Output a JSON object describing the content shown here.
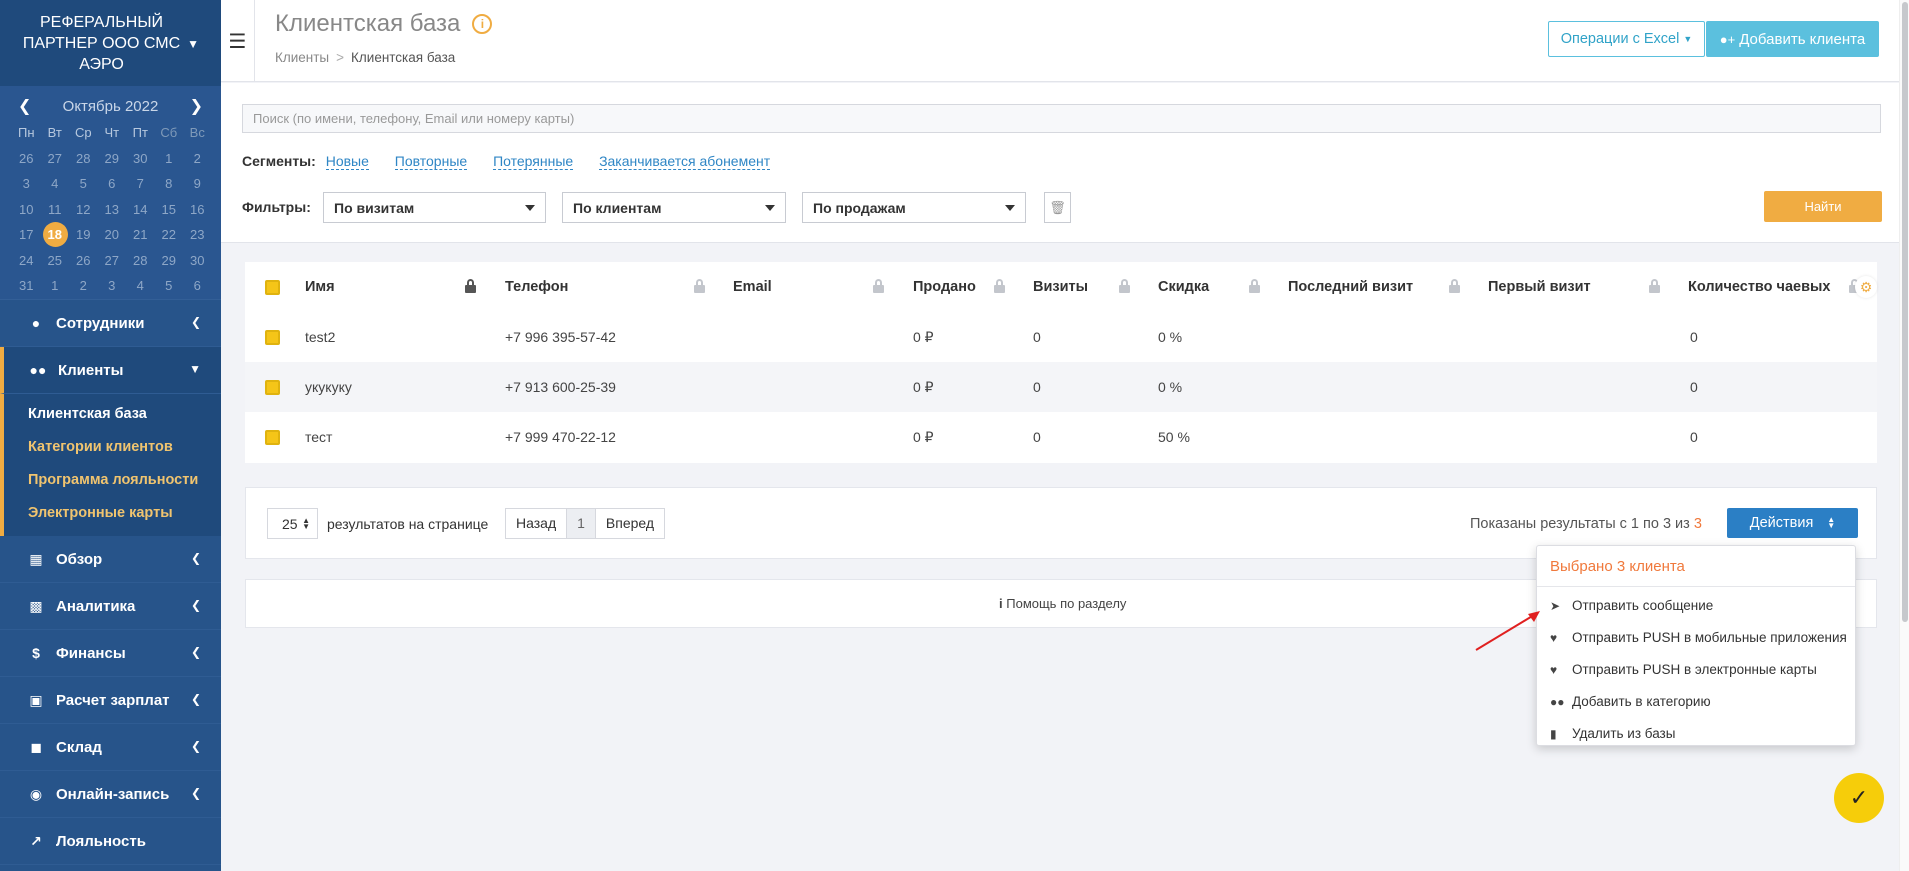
{
  "sidebar": {
    "org_name": "РЕФЕРАЛЬНЫЙ ПАРТНЕР ООО СМС АЭРО",
    "calendar": {
      "month": "Октябрь 2022",
      "weekdays": [
        "Пн",
        "Вт",
        "Ср",
        "Чт",
        "Пт",
        "Сб",
        "Вс"
      ],
      "days": [
        "26",
        "27",
        "28",
        "29",
        "30",
        "1",
        "2",
        "3",
        "4",
        "5",
        "6",
        "7",
        "8",
        "9",
        "10",
        "11",
        "12",
        "13",
        "14",
        "15",
        "16",
        "17",
        "18",
        "19",
        "20",
        "21",
        "22",
        "23",
        "24",
        "25",
        "26",
        "27",
        "28",
        "29",
        "30",
        "31",
        "1",
        "2",
        "3",
        "4",
        "5",
        "6"
      ],
      "today": "18"
    },
    "nav": [
      {
        "label": "Сотрудники",
        "icon": "user-icon"
      },
      {
        "label": "Клиенты",
        "icon": "users-icon"
      },
      {
        "label": "Обзор",
        "icon": "grid-icon"
      },
      {
        "label": "Аналитика",
        "icon": "chart-icon"
      },
      {
        "label": "Финансы",
        "icon": "dollar-icon"
      },
      {
        "label": "Расчет зарплат",
        "icon": "wallet-icon"
      },
      {
        "label": "Склад",
        "icon": "cubes-icon"
      },
      {
        "label": "Онлайн-запись",
        "icon": "globe-icon"
      },
      {
        "label": "Лояльность",
        "icon": "line-chart-icon"
      }
    ],
    "subnav": [
      "Клиентская база",
      "Категории клиентов",
      "Программа лояльности",
      "Электронные карты"
    ]
  },
  "header": {
    "title": "Клиентская база",
    "breadcrumb": [
      "Клиенты",
      "Клиентская база"
    ],
    "excel_label": "Операции с Excel",
    "add_label": "Добавить клиента"
  },
  "filters": {
    "search_placeholder": "Поиск (по имени, телефону, Email или номеру карты)",
    "segments_label": "Сегменты:",
    "segments": [
      "Новые",
      "Повторные",
      "Потерянные",
      "Заканчивается абонемент"
    ],
    "filters_label": "Фильтры:",
    "selects": [
      "По визитам",
      "По клиентам",
      "По продажам"
    ],
    "find_label": "Найти"
  },
  "table": {
    "columns": [
      "Имя",
      "Телефон",
      "Email",
      "Продано",
      "Визиты",
      "Скидка",
      "Последний визит",
      "Первый визит",
      "Количество чаевых"
    ],
    "rows": [
      {
        "name": "test2",
        "phone": "+7 996 395-57-42",
        "email": "",
        "sold": "0 ₽",
        "visits": "0",
        "discount": "0 %",
        "last": "",
        "first": "",
        "tips": "0"
      },
      {
        "name": "укукуку",
        "phone": "+7 913 600-25-39",
        "email": "",
        "sold": "0 ₽",
        "visits": "0",
        "discount": "0 %",
        "last": "",
        "first": "",
        "tips": "0"
      },
      {
        "name": "тест",
        "phone": "+7 999 470-22-12",
        "email": "",
        "sold": "0 ₽",
        "visits": "0",
        "discount": "50 %",
        "last": "",
        "first": "",
        "tips": "0"
      }
    ]
  },
  "pagination": {
    "per_page": "25",
    "per_page_label": "результатов на странице",
    "prev": "Назад",
    "page": "1",
    "next": "Вперед",
    "shown_prefix": "Показаны результаты с 1 по 3 из",
    "shown_total": "3",
    "actions_label": "Действия"
  },
  "help_label": "Помощь по разделу",
  "actions_menu": {
    "header": "Выбрано 3 клиента",
    "items": [
      {
        "label": "Отправить сообщение",
        "icon": "paper-plane-icon"
      },
      {
        "label": "Отправить PUSH в мобильные приложения",
        "icon": "bell-icon"
      },
      {
        "label": "Отправить PUSH в электронные карты",
        "icon": "bell-icon"
      },
      {
        "label": "Добавить в категорию",
        "icon": "users-icon"
      },
      {
        "label": "Удалить из базы",
        "icon": "trash-icon"
      }
    ]
  },
  "colors": {
    "sidebar": "#27548a",
    "accent": "#f0ac42",
    "primary": "#2b7fc5",
    "info": "#5bc0de"
  }
}
